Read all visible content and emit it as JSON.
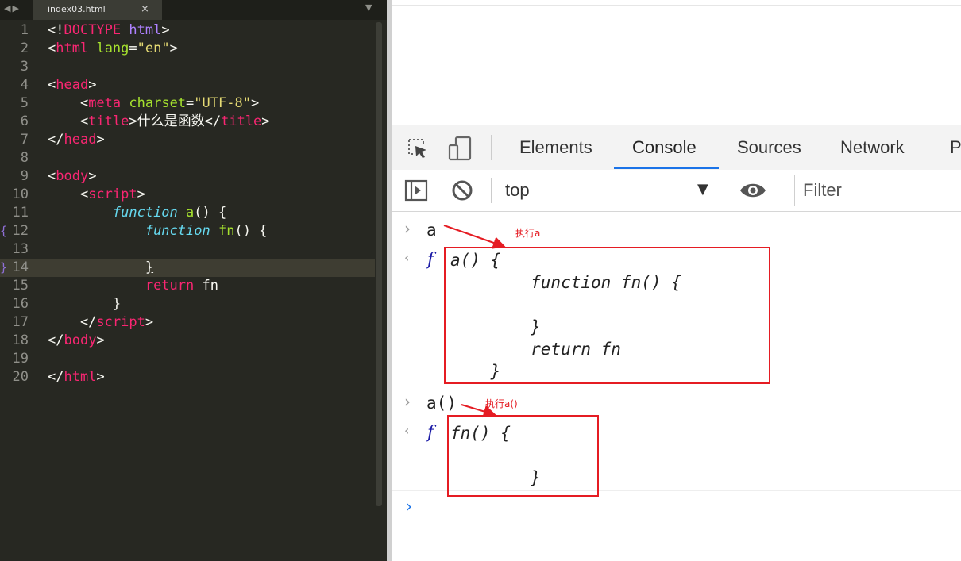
{
  "editor": {
    "tab_nav": "◀▶",
    "tab_title": "index03.html",
    "tab_close": "×",
    "tab_menu": "▼",
    "lines": [
      {
        "num": "1",
        "tokens": [
          [
            "p",
            "<!"
          ],
          [
            "t",
            "DOCTYPE"
          ],
          [
            "p",
            " "
          ],
          [
            "k",
            "html"
          ],
          [
            "p",
            ">"
          ]
        ]
      },
      {
        "num": "2",
        "tokens": [
          [
            "p",
            "<"
          ],
          [
            "t",
            "html"
          ],
          [
            "p",
            " "
          ],
          [
            "a",
            "lang"
          ],
          [
            "p",
            "="
          ],
          [
            "s",
            "\"en\""
          ],
          [
            "p",
            ">"
          ]
        ]
      },
      {
        "num": "3",
        "tokens": []
      },
      {
        "num": "4",
        "tokens": [
          [
            "p",
            "<"
          ],
          [
            "t",
            "head"
          ],
          [
            "p",
            ">"
          ]
        ]
      },
      {
        "num": "5",
        "tokens": [
          [
            "p",
            "    <"
          ],
          [
            "t",
            "meta"
          ],
          [
            "p",
            " "
          ],
          [
            "a",
            "charset"
          ],
          [
            "p",
            "="
          ],
          [
            "s",
            "\"UTF-8\""
          ],
          [
            "p",
            ">"
          ]
        ]
      },
      {
        "num": "6",
        "tokens": [
          [
            "p",
            "    <"
          ],
          [
            "t",
            "title"
          ],
          [
            "p",
            ">"
          ],
          [
            "x",
            "什么是函数"
          ],
          [
            "p",
            "</"
          ],
          [
            "t",
            "title"
          ],
          [
            "p",
            ">"
          ]
        ]
      },
      {
        "num": "7",
        "tokens": [
          [
            "p",
            "</"
          ],
          [
            "t",
            "head"
          ],
          [
            "p",
            ">"
          ]
        ]
      },
      {
        "num": "8",
        "tokens": []
      },
      {
        "num": "9",
        "tokens": [
          [
            "p",
            "<"
          ],
          [
            "t",
            "body"
          ],
          [
            "p",
            ">"
          ]
        ]
      },
      {
        "num": "10",
        "tokens": [
          [
            "p",
            "    <"
          ],
          [
            "t",
            "script"
          ],
          [
            "p",
            ">"
          ]
        ]
      },
      {
        "num": "11",
        "tokens": [
          [
            "p",
            "        "
          ],
          [
            "o",
            "function"
          ],
          [
            "p",
            " "
          ],
          [
            "f",
            "a"
          ],
          [
            "p",
            "() {"
          ]
        ]
      },
      {
        "num": "12",
        "fold": "{",
        "tokens": [
          [
            "p",
            "            "
          ],
          [
            "o",
            "function"
          ],
          [
            "p",
            " "
          ],
          [
            "f",
            "fn"
          ],
          [
            "p",
            "() "
          ],
          [
            "u",
            "{"
          ]
        ]
      },
      {
        "num": "13",
        "tokens": []
      },
      {
        "num": "14",
        "fold": "}",
        "active": true,
        "tokens": [
          [
            "p",
            "            "
          ],
          [
            "u",
            "}"
          ]
        ]
      },
      {
        "num": "15",
        "tokens": [
          [
            "p",
            "            "
          ],
          [
            "kw",
            "return"
          ],
          [
            "x",
            " fn"
          ]
        ]
      },
      {
        "num": "16",
        "tokens": [
          [
            "p",
            "        }"
          ]
        ]
      },
      {
        "num": "17",
        "tokens": [
          [
            "p",
            "    </"
          ],
          [
            "t",
            "script"
          ],
          [
            "p",
            ">"
          ]
        ]
      },
      {
        "num": "18",
        "tokens": [
          [
            "p",
            "</"
          ],
          [
            "t",
            "body"
          ],
          [
            "p",
            ">"
          ]
        ]
      },
      {
        "num": "19",
        "tokens": []
      },
      {
        "num": "20",
        "tokens": [
          [
            "p",
            "</"
          ],
          [
            "t",
            "html"
          ],
          [
            "p",
            ">"
          ]
        ]
      }
    ]
  },
  "devtools": {
    "tabs": [
      "Elements",
      "Console",
      "Sources",
      "Network",
      "P"
    ],
    "active_tab": "Console",
    "context": "top",
    "filter_placeholder": "Filter",
    "accent": "#1a73e8"
  },
  "console": {
    "entries": [
      {
        "input": "a",
        "annotation": "执行a",
        "output_marker": "f",
        "output": "a() {\n        function fn() {\n\n        }\n        return fn\n    }"
      },
      {
        "input": "a()",
        "annotation": "执行a()",
        "output_marker": "f",
        "output": "fn() {\n\n        }"
      }
    ],
    "prompt": "›"
  },
  "annotation_color": "#e51c23"
}
